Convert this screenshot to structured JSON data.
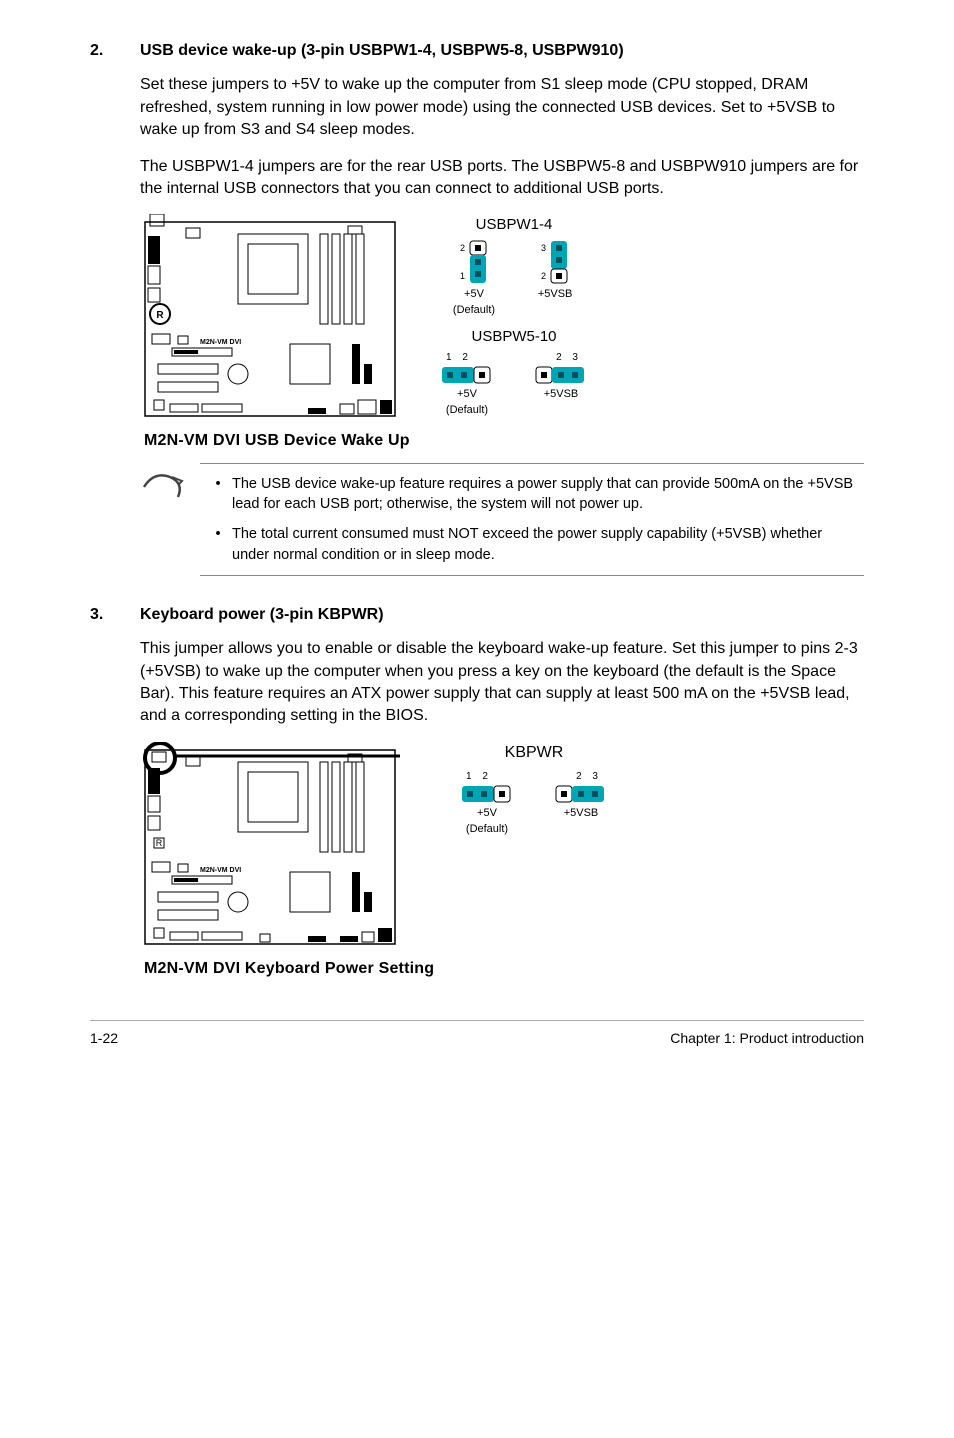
{
  "section2": {
    "num": "2.",
    "title": "USB device wake-up (3-pin USBPW1-4, USBPW5-8, USBPW910)",
    "para1": "Set these jumpers to +5V to wake up the computer from S1 sleep mode (CPU stopped, DRAM refreshed, system running in low power mode) using the connected USB devices. Set to +5VSB to wake up from S3 and S4 sleep modes.",
    "para2": "The USBPW1-4 jumpers are for the rear USB ports. The USBPW5-8 and USBPW910 jumpers are for the internal USB connectors that you can connect to additional USB ports.",
    "diagram": {
      "group1_title": "USBPW1-4",
      "group2_title": "USBPW5-10",
      "pos_a_label": "+5V",
      "pos_a_sub": "(Default)",
      "pos_b_label": "+5VSB",
      "pins_h_left": "1  2",
      "pins_h_right": "2  3",
      "pins_v_left_min": "1",
      "pins_v_left_max": "2",
      "pins_v_right_min": "2",
      "pins_v_right_max": "3",
      "board_label": "M2N-VM DVI",
      "caption": "M2N-VM DVI USB Device Wake Up"
    },
    "notes": {
      "n1": "The USB device wake-up feature requires a power supply that can provide 500mA on the +5VSB lead for each USB port; otherwise, the system will not power up.",
      "n2": "The total current consumed must NOT exceed the power supply capability (+5VSB) whether under normal condition or in sleep mode."
    }
  },
  "section3": {
    "num": "3.",
    "title": "Keyboard power (3-pin KBPWR)",
    "para1": "This jumper allows you to enable or disable the keyboard wake-up feature. Set this jumper to pins 2-3 (+5VSB) to wake up the computer when you press a key on the keyboard (the default is the Space Bar). This feature requires an ATX power supply that can supply at least 500 mA on the +5VSB lead, and a corresponding setting in the BIOS.",
    "diagram": {
      "title": "KBPWR",
      "pos_a_label": "+5V",
      "pos_a_sub": "(Default)",
      "pos_b_label": "+5VSB",
      "pins_left": "1  2",
      "pins_right": "2  3",
      "board_label": "M2N-VM DVI",
      "caption": "M2N-VM DVI Keyboard Power Setting"
    }
  },
  "footer": {
    "left": "1-22",
    "right": "Chapter 1: Product introduction"
  }
}
